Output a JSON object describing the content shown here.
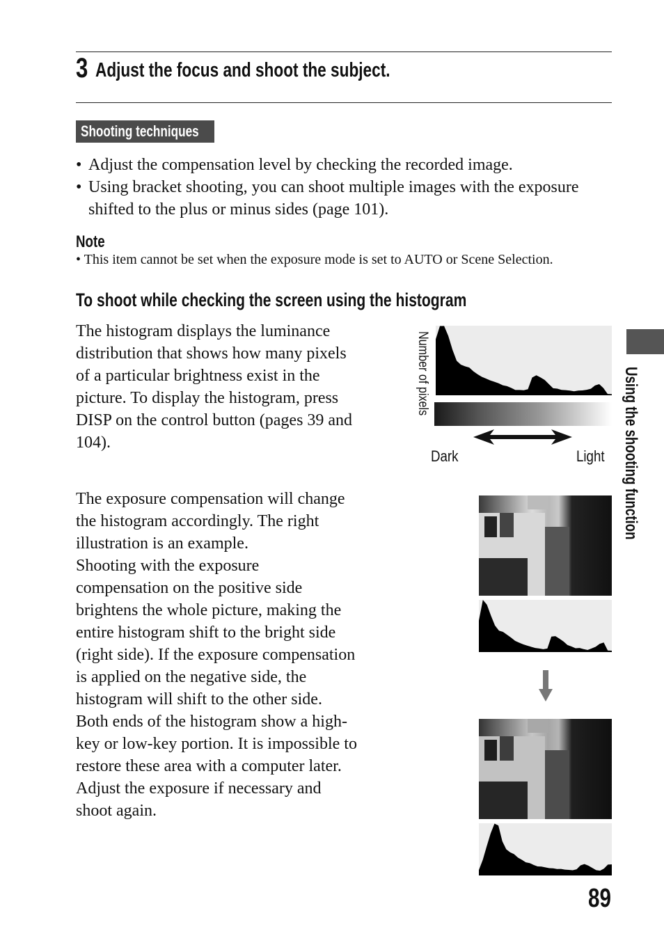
{
  "step": {
    "number": "3",
    "title": "Adjust the focus and shoot the subject."
  },
  "techniques": {
    "label": "Shooting techniques",
    "bullets": [
      [
        "Adjust the compensation level by checking the recorded image."
      ],
      [
        "Using bracket shooting, you can shoot multiple images with the exposure",
        "shifted to the plus or minus sides (page 101)."
      ]
    ]
  },
  "note": {
    "label": "Note",
    "text": "This item cannot be set when the exposure mode is set to AUTO or Scene Selection."
  },
  "section": {
    "title": "To shoot while checking the screen using the histogram",
    "paragraph1": [
      "The histogram displays the luminance",
      "distribution that shows how many pixels",
      "of a particular brightness exist in the",
      "picture. To display the histogram, press",
      "DISP on the control button (pages 39 and",
      "104)."
    ],
    "paragraph2": [
      "The exposure compensation will change",
      "the histogram accordingly. The right",
      "illustration is an example.",
      "Shooting with the exposure",
      "compensation on the positive side",
      "brightens the whole picture, making the",
      "entire histogram shift to the bright side",
      "(right side). If the exposure compensation",
      "is applied on the negative side, the",
      "histogram will shift to the other side.",
      "Both ends of the histogram show a high-",
      "key or low-key portion. It is impossible to",
      "restore these area with a computer later.",
      "Adjust the exposure if necessary and",
      "shoot again."
    ]
  },
  "diagram": {
    "y_label": "Number of pixels",
    "dark_label": "Dark",
    "light_label": "Light"
  },
  "side_tab": {
    "label": "Using the shooting function",
    "color": "#555555"
  },
  "page_number": "89"
}
